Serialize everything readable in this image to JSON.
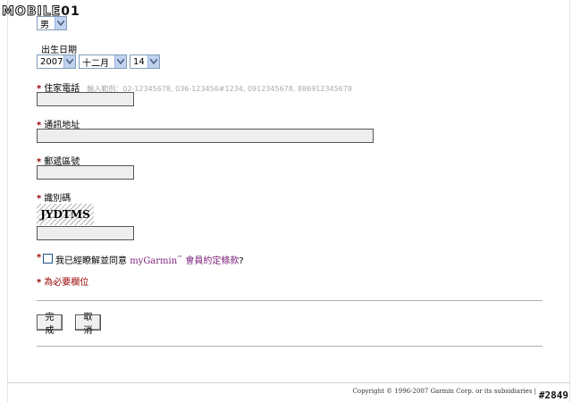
{
  "logo": {
    "text_part1": "MOBILE",
    "text_part2": "01"
  },
  "gender": {
    "selected": "男"
  },
  "birthdate": {
    "label": "出生日期",
    "year": "2007",
    "month": "十二月",
    "day": "14"
  },
  "phone": {
    "label": "住家電話",
    "hint": "輸入範例：02-12345678, 036-123456#1234, 0912345678, 886912345678",
    "value": ""
  },
  "address": {
    "label": "通訊地址",
    "value": ""
  },
  "zip": {
    "label": "郵遞區號",
    "value": ""
  },
  "captcha": {
    "label": "識別碼",
    "image_text": "JYDTMS",
    "value": ""
  },
  "agreement": {
    "prefix": "我已經瞭解並同意",
    "link_text": "myGarmin",
    "tm": "™",
    "suffix_link": "會員約定條款",
    "end": "?"
  },
  "required_note": {
    "star": "*",
    "text": "為必要欄位"
  },
  "buttons": {
    "submit": "完成",
    "cancel": "取消"
  },
  "footer": {
    "copyright": "Copyright © 1996-2007 Garmin Corp. or its subsidiaries |",
    "watermark": "#2849"
  },
  "colors": {
    "required": "#990000",
    "link": "#7b1f7b",
    "input_bg": "#eeeeee"
  }
}
